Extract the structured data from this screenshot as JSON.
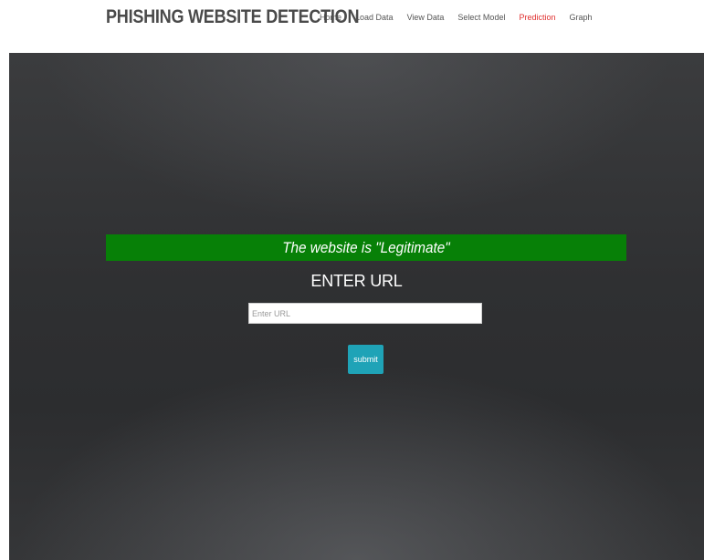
{
  "header": {
    "brand": "PHISHING WEBSITE DETECTION",
    "nav": [
      {
        "label": "Home"
      },
      {
        "label": "Load Data"
      },
      {
        "label": "View Data"
      },
      {
        "label": "Select Model"
      },
      {
        "label": "Prediction",
        "active": true
      },
      {
        "label": "Graph"
      }
    ]
  },
  "main": {
    "result": "The website is \"Legitimate\"",
    "form_title": "ENTER URL",
    "url_input": {
      "value": "",
      "placeholder": "Enter URL"
    },
    "submit_label": "submit"
  },
  "colors": {
    "brand_text": "#4a4a4a",
    "nav_active": "#e0302f",
    "result_banner": "#078007",
    "submit_button": "#1fa3b7",
    "hero_background": "#2f3032"
  }
}
